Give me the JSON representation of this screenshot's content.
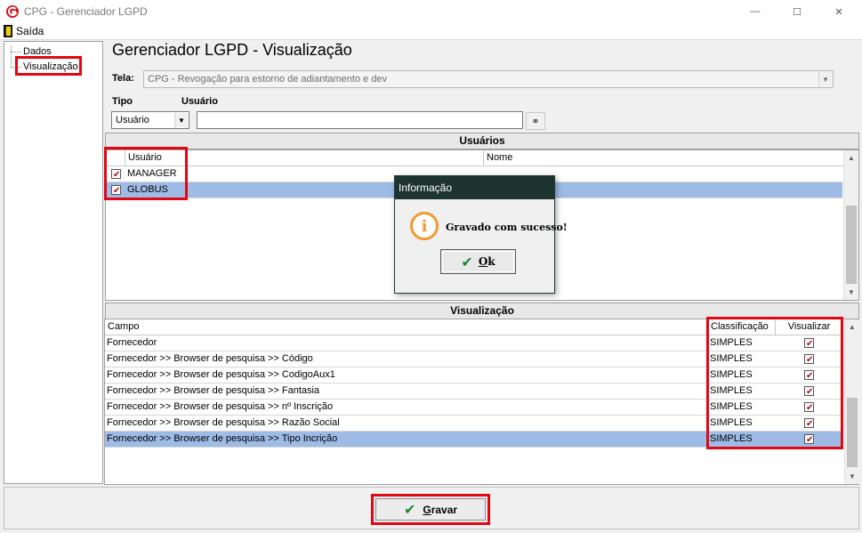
{
  "window": {
    "title": "CPG - Gerenciador LGPD",
    "minimize_glyph": "—",
    "maximize_glyph": "☐",
    "close_glyph": "✕"
  },
  "menu": {
    "exit_label": "Saída"
  },
  "tree": {
    "items": [
      {
        "label": "Dados"
      },
      {
        "label": "Visualização"
      }
    ]
  },
  "main": {
    "title": "Gerenciador LGPD - Visualização",
    "screen_label": "Tela:",
    "screen_value": "CPG - Revogação para estorno de adiantamento e dev",
    "type_label": "Tipo",
    "type_value": "Usuário",
    "user_label": "Usuário",
    "user_value": ""
  },
  "users": {
    "header": "Usuários",
    "columns": [
      "Usuário",
      "Nome"
    ],
    "rows": [
      {
        "user": "MANAGER",
        "name": "",
        "checked": true
      },
      {
        "user": "GLOBUS",
        "name": "",
        "checked": true
      }
    ]
  },
  "visualization": {
    "header": "Visualização",
    "columns": [
      "Campo",
      "Classificação",
      "Visualizar"
    ],
    "rows": [
      {
        "field": "Fornecedor",
        "classification": "SIMPLES",
        "visible": true
      },
      {
        "field": "Fornecedor >> Browser de pesquisa >> Código",
        "classification": "SIMPLES",
        "visible": true
      },
      {
        "field": "Fornecedor >> Browser de pesquisa >> CodigoAux1",
        "classification": "SIMPLES",
        "visible": true
      },
      {
        "field": "Fornecedor >> Browser de pesquisa >> Fantasia",
        "classification": "SIMPLES",
        "visible": true
      },
      {
        "field": "Fornecedor >> Browser de pesquisa >> nº Inscrição",
        "classification": "SIMPLES",
        "visible": true
      },
      {
        "field": "Fornecedor >> Browser de pesquisa >> Razão Social",
        "classification": "SIMPLES",
        "visible": true
      },
      {
        "field": "Fornecedor >> Browser de pesquisa >> Tipo Incrição",
        "classification": "SIMPLES",
        "visible": true
      }
    ]
  },
  "dialog": {
    "title": "Informação",
    "message": "Gravado com sucesso!",
    "ok_label": "Ok"
  },
  "footer": {
    "save_label": "Gravar"
  },
  "colors": {
    "highlight": "#e30613",
    "selection": "#9ebbe6",
    "dialog_title_bg": "#1c3330",
    "info_icon": "#f29a2e",
    "check": "#1b8a2e"
  }
}
